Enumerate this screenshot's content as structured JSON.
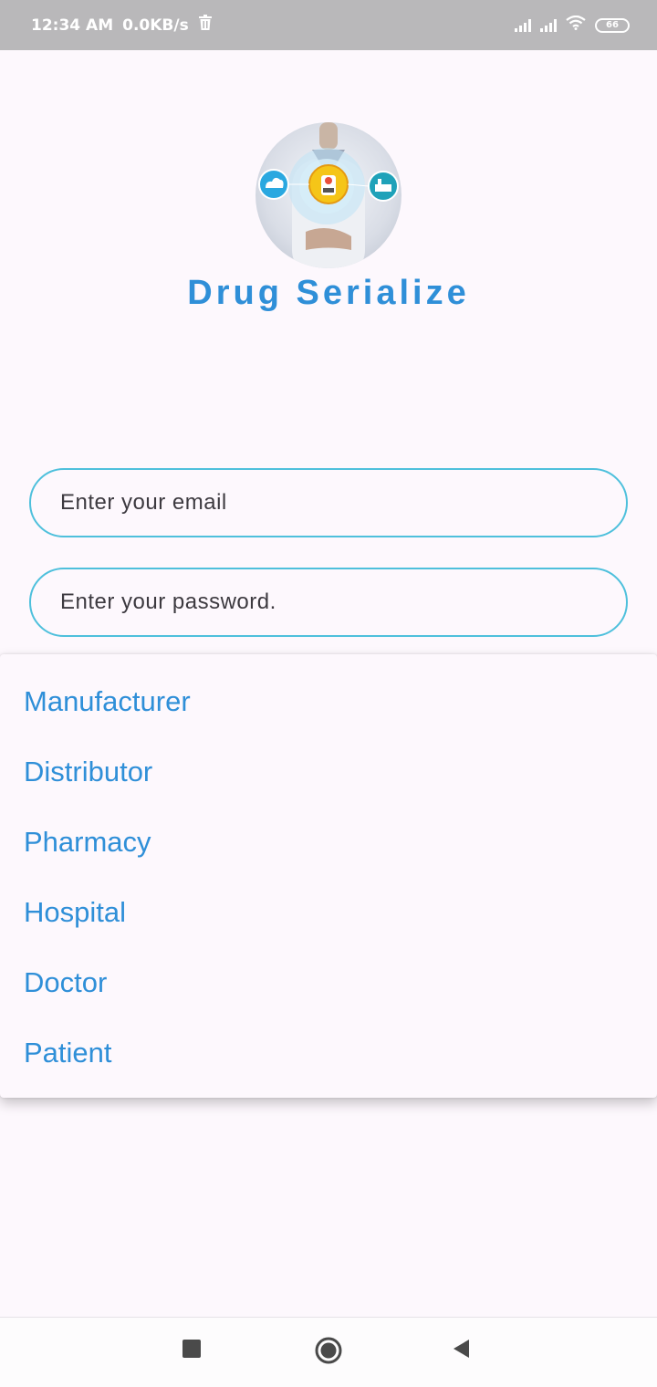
{
  "status_bar": {
    "time": "12:34 AM",
    "net_speed": "0.0KB/s",
    "battery": "66"
  },
  "app": {
    "title": "Drug Serialize"
  },
  "form": {
    "email_placeholder": "Enter your email",
    "password_placeholder": "Enter your password."
  },
  "role_menu": {
    "items": [
      "Manufacturer",
      "Distributor",
      "Pharmacy",
      "Hospital",
      "Doctor",
      "Patient"
    ]
  },
  "colors": {
    "accent": "#2f8fd8",
    "field_border": "#4ec0dc",
    "status_bar": "#b9b8ba",
    "background": "#fdf8fd"
  },
  "icons": {
    "nav_recents": "square-icon",
    "nav_home": "circle-icon",
    "nav_back": "triangle-back-icon"
  }
}
